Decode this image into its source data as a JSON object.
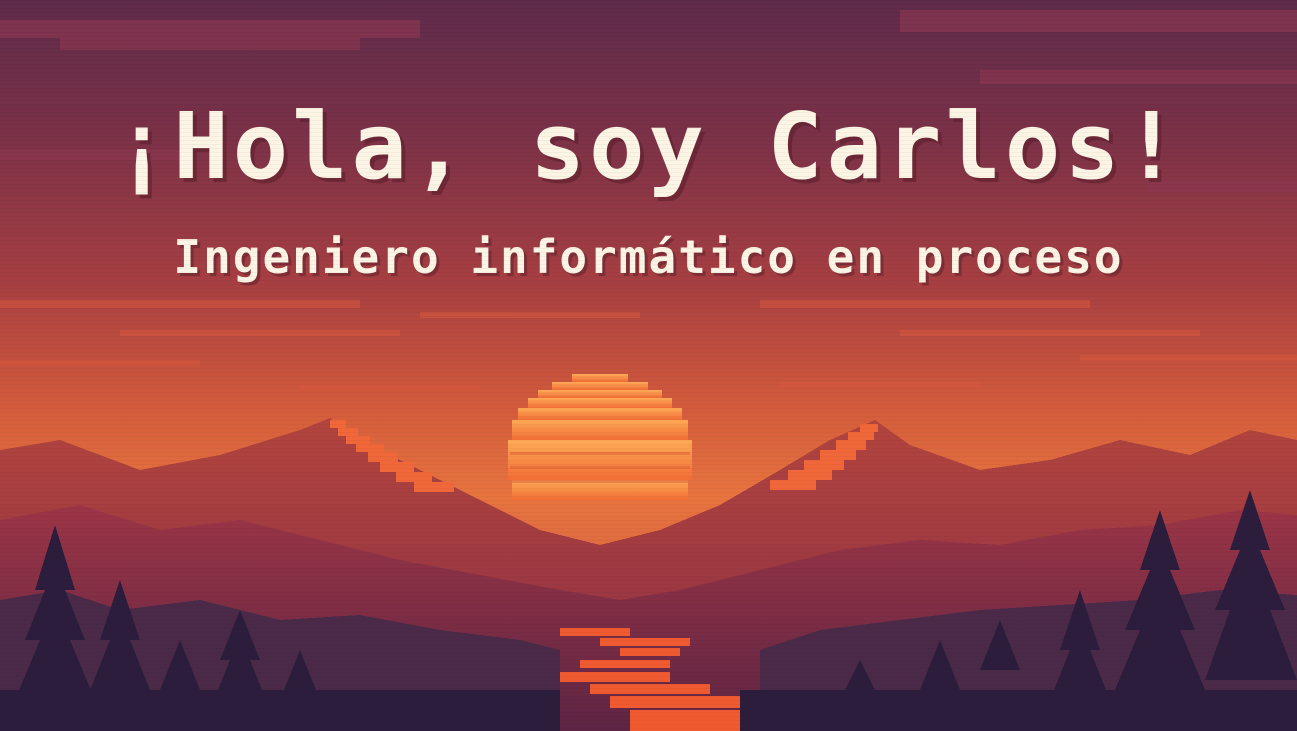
{
  "hero": {
    "headline": "¡Hola, soy Carlos!",
    "subtitle": "Ingeniero informático en proceso"
  },
  "scene": {
    "description_icons": [
      "sunset-sky",
      "sun",
      "mountains",
      "pine-trees",
      "river"
    ],
    "colors": {
      "sky_top": "#6a2f4f",
      "sky_mid": "#b2443e",
      "sky_low": "#e06a3c",
      "sun": "#f7913f",
      "sun_highlight": "#ffb45c",
      "mountain_far": "#a5394a",
      "mountain_near": "#7a2d47",
      "ridge_light": "#f26a3b",
      "forest_dark": "#2c1d3c",
      "forest_mid": "#4a2a48",
      "river": "#f05a30",
      "text": "#fcf4e4"
    }
  }
}
